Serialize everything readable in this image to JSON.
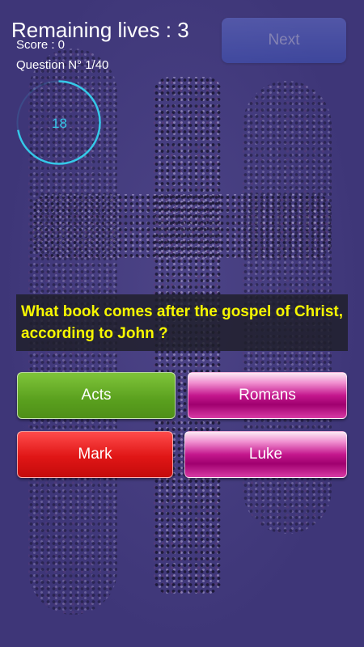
{
  "header": {
    "lives_text": "Remaining lives : 3",
    "score_text": "Score : 0",
    "question_number_text": "Question N° 1/40",
    "next_label": "Next"
  },
  "timer": {
    "value": "18",
    "color": "#35c8e8",
    "progress": 0.72
  },
  "question": {
    "text": "What book comes after the gospel of Christ, according to John ?"
  },
  "answers": [
    {
      "label": "Acts",
      "color": "green"
    },
    {
      "label": "Romans",
      "color": "pink"
    },
    {
      "label": "Mark",
      "color": "red"
    },
    {
      "label": "Luke",
      "color": "pink"
    }
  ]
}
